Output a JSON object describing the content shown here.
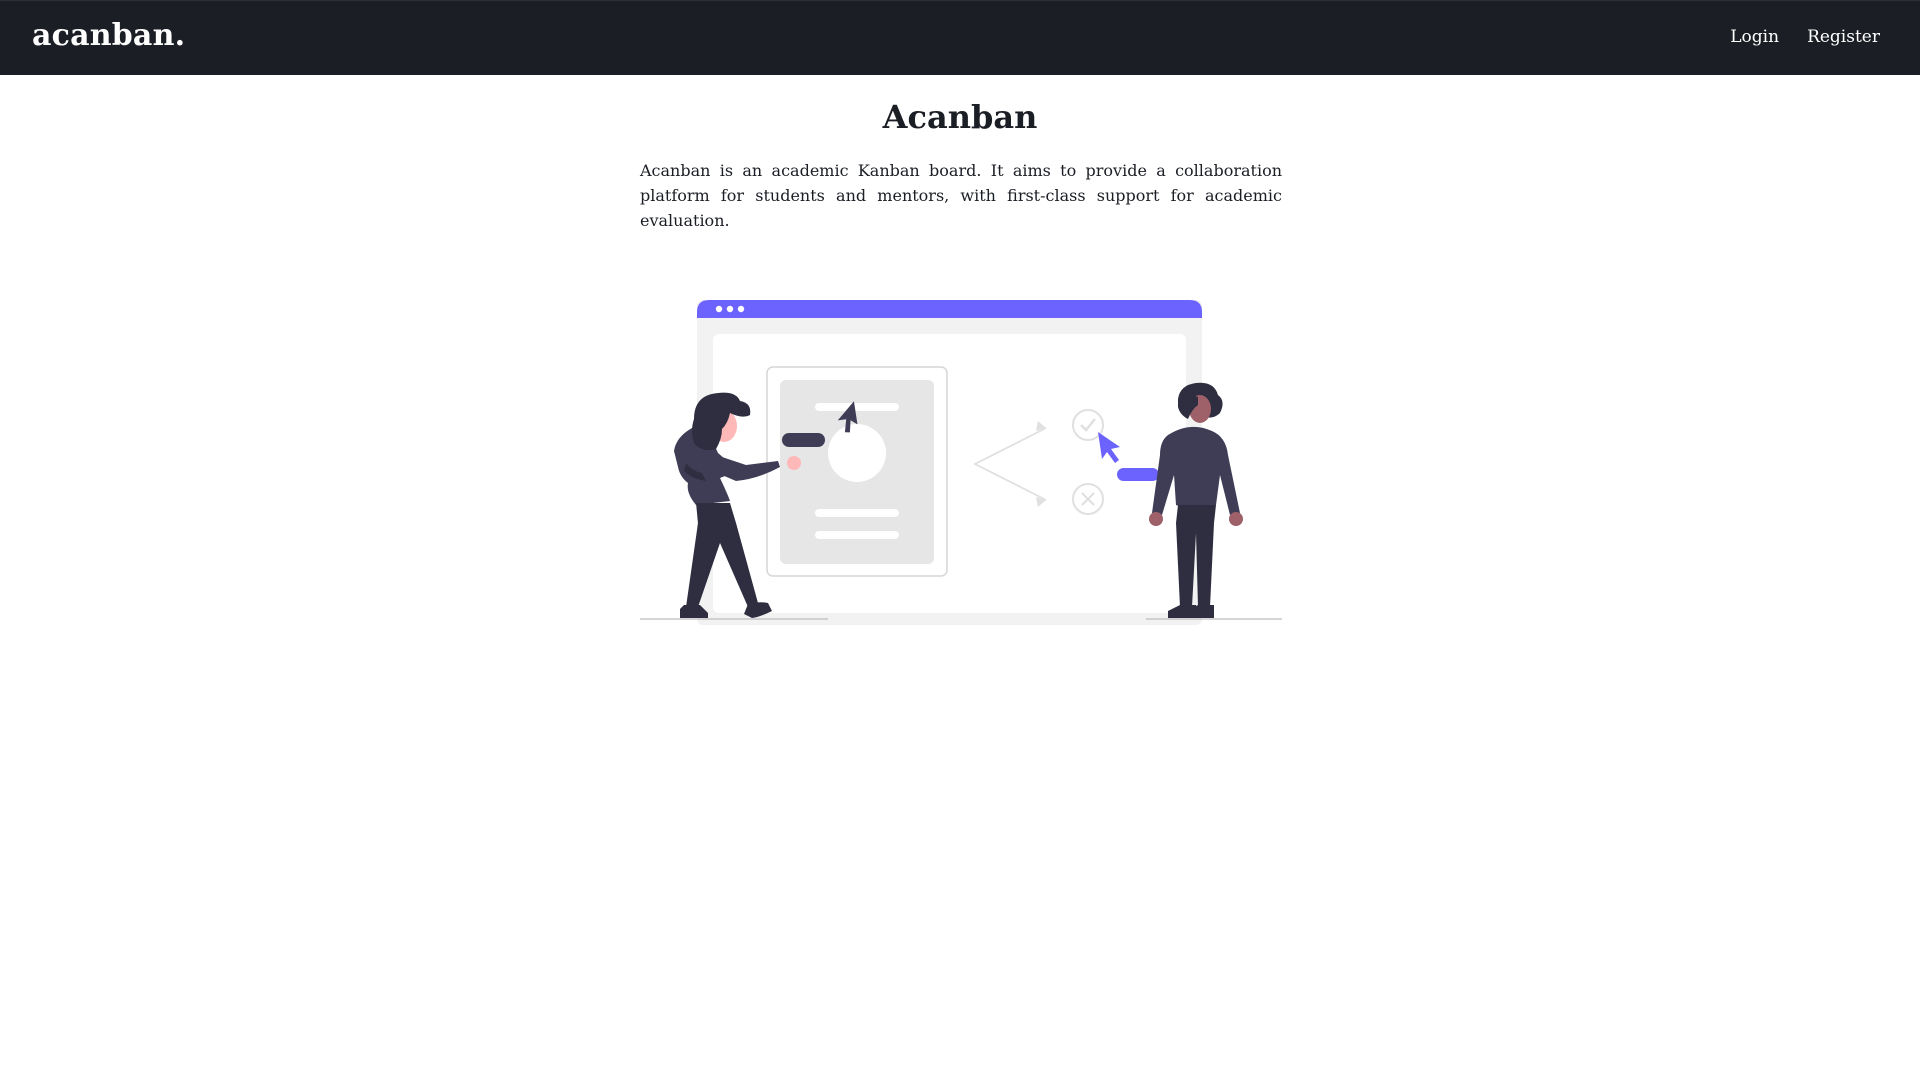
{
  "navbar": {
    "brand": "acanban.",
    "links": [
      "Login",
      "Register"
    ]
  },
  "main": {
    "title": "Acanban",
    "description": "Acanban is an academic Kanban board. It aims to provide a collaboration platform for students and mentors, with first-class support for academic evaluation."
  },
  "illustration": {
    "icon": "people-collaboration-illustration",
    "accent": "#6c63ff",
    "dark": "#3f3d56",
    "light": "#f2f2f2",
    "skin": "#ffb8b8"
  }
}
